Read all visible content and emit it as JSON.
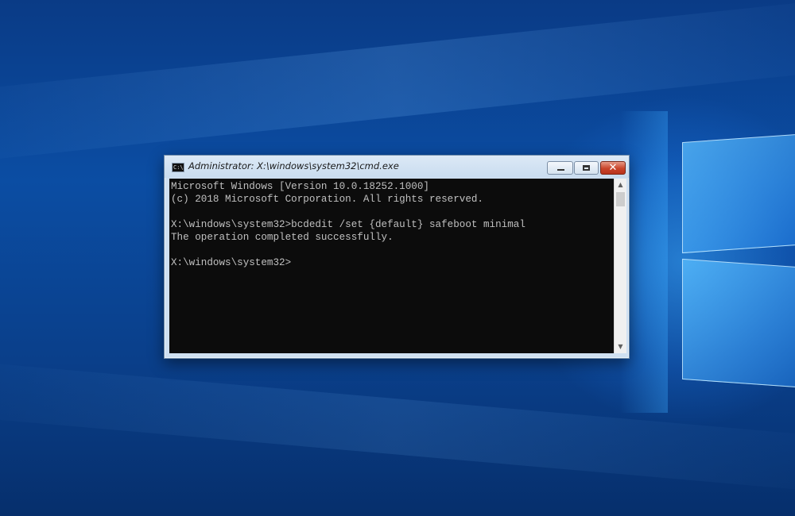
{
  "window": {
    "title": "Administrator: X:\\windows\\system32\\cmd.exe",
    "app_icon_text": "C:\\"
  },
  "controls": {
    "close_glyph": "✕"
  },
  "console": {
    "lines": [
      "Microsoft Windows [Version 10.0.18252.1000]",
      "(c) 2018 Microsoft Corporation. All rights reserved.",
      "",
      "X:\\windows\\system32>bcdedit /set {default} safeboot minimal",
      "The operation completed successfully.",
      "",
      "X:\\windows\\system32>"
    ]
  },
  "scrollbar": {
    "up_glyph": "▲",
    "down_glyph": "▼"
  },
  "colors": {
    "console_background": "#0c0c0c",
    "console_text": "#c0c0c0",
    "close_button": "#c9442b",
    "wallpaper_accent": "#0b4da3"
  }
}
